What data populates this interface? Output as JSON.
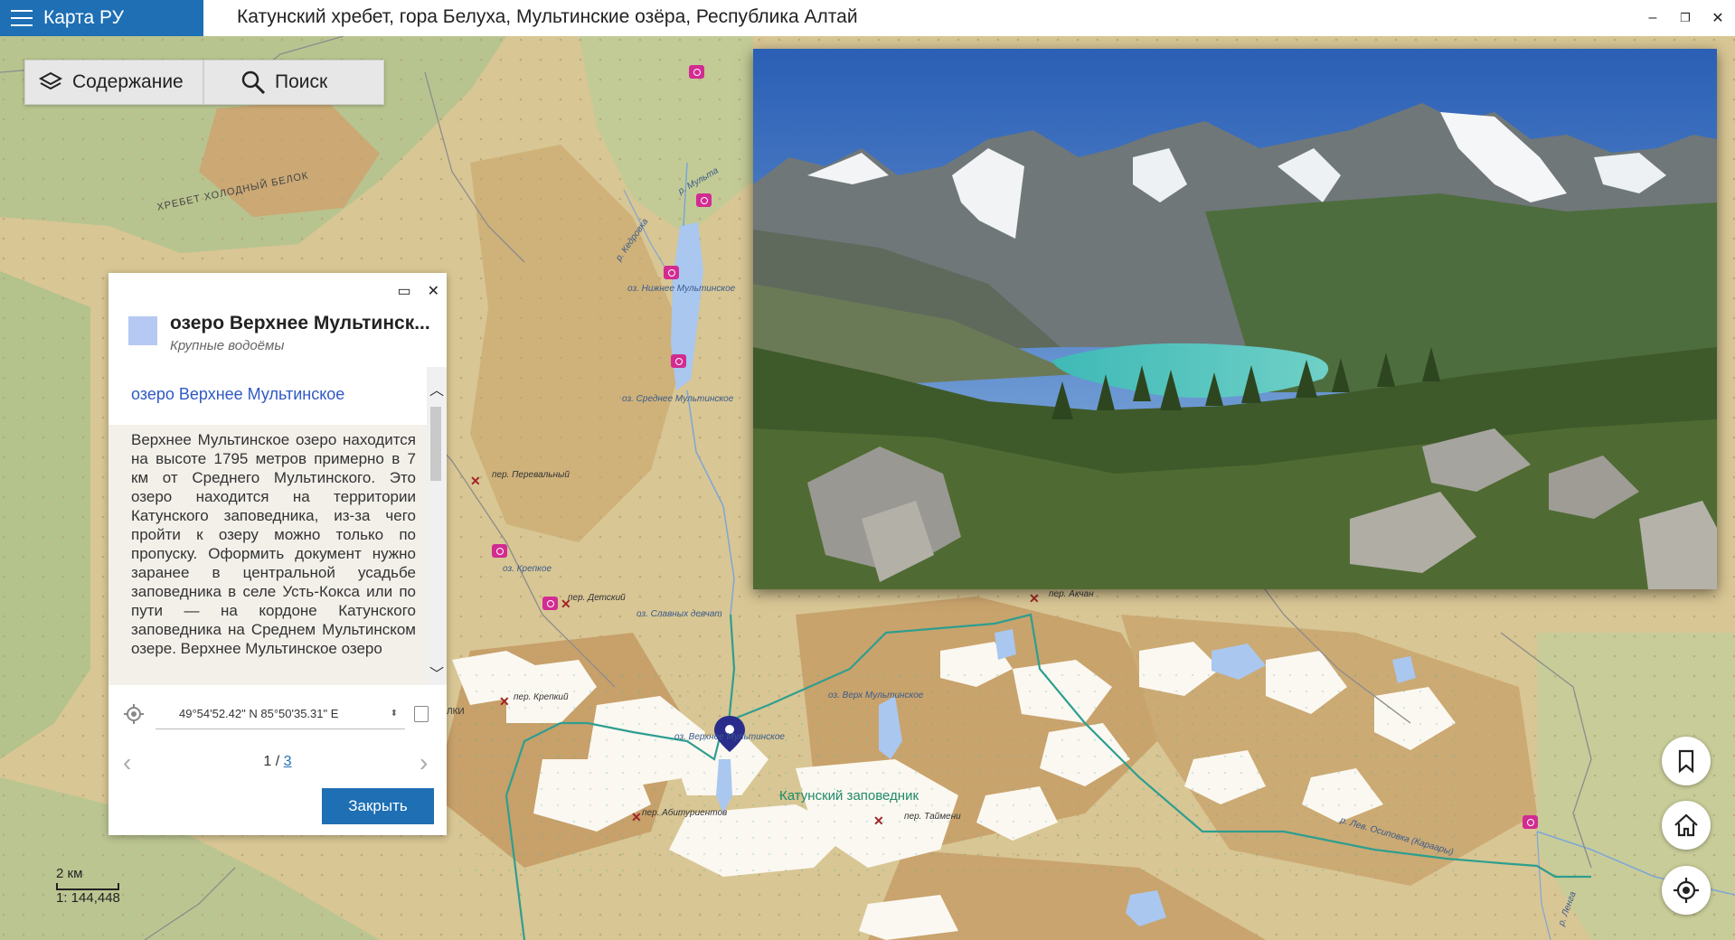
{
  "app": {
    "name": "Карта РУ",
    "menu_icon": "hamburger-icon"
  },
  "window": {
    "title": "Катунский хребет, гора Белуха, Мультинские озёра, Республика Алтай",
    "minimize": "–",
    "restore": "❐",
    "close": "✕"
  },
  "toolbar": {
    "contents_label": "Содержание",
    "contents_icon": "layers-icon",
    "search_label": "Поиск",
    "search_icon": "search-icon"
  },
  "panel": {
    "maximize": "▭",
    "close": "✕",
    "title": "озеро Верхнее Мультинск...",
    "subtitle": "Крупные водоёмы",
    "link": "озеро Верхнее Мультинское",
    "description": "Верхнее Мультинское озеро находится на высоте 1795 метров примерно в 7 км от Среднего Мультинского. Это озеро находится на территории Катунского заповедника, из-за чего пройти к озеру можно только по пропуску. Оформить документ нужно заранее в центральной усадьбе заповедника в селе Усть-Кокса или по пути — на кордоне Катунского заповедника на Среднем Мультинском озере. Верхнее Мультинское озеро",
    "coordinates": "49°54'52.42\" N 85°50'35.31\" E",
    "page_current": "1",
    "page_sep": " / ",
    "page_total": "3",
    "close_button": "Закрыть",
    "swatch_color": "#b6c9f2"
  },
  "map_labels": {
    "ridge": "ХРЕБЕТ ХОЛОДНЫЙ БЕЛОК",
    "river_multa": "р. Мульта",
    "river_kedrovka": "р. Кедровка",
    "lake_lower": "оз. Нижнее Мультинское",
    "lake_middle": "оз. Среднее Мультинское",
    "lake_krepkoe": "оз. Крепкое",
    "lake_slavnyh": "оз. Славных девчат",
    "lake_upper_selected": "оз. Верхнее Мультинское",
    "lake_upper_east": "оз. Верх Мультинское",
    "pass_perevalny": "пер. Перевальный",
    "pass_detsky": "пер. Детский",
    "pass_krepky": "пер. Крепкий",
    "pass_abiturientov": "пер. Абитуриентов",
    "pass_taymeni": "пер. Таймени",
    "pass_akchan": "пер. Акчан",
    "river_east": "р. Лев. Осиповка (Караары)",
    "river_lenga": "р. Ленга",
    "reserve": "Катунский заповедник",
    "edge_fragment": "ЛКИ"
  },
  "scale": {
    "distance": "2 км",
    "ratio": "1: 144,448"
  },
  "fabs": {
    "bookmark": "bookmark-icon",
    "home": "home-icon",
    "locate": "locate-icon"
  },
  "colors": {
    "accent": "#1e6fb4",
    "poi": "#d22b91",
    "trail": "#2e9e8f",
    "lake": "#a9c7ef"
  }
}
